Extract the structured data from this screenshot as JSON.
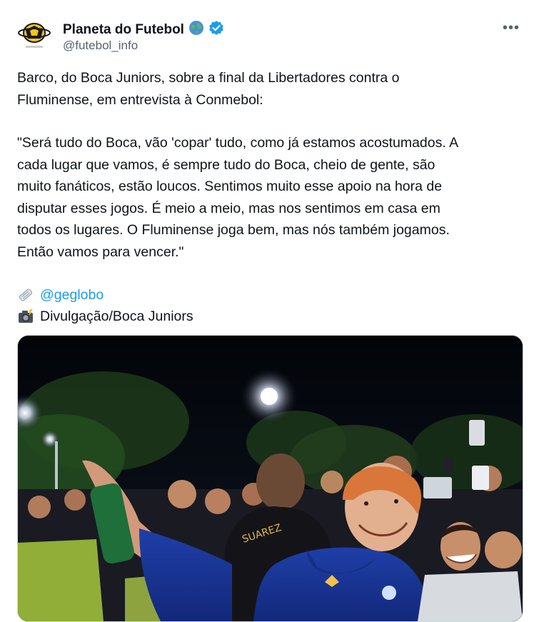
{
  "account": {
    "name": "Planeta do Futebol",
    "handle": "@futebol_info",
    "verified": true,
    "name_emoji": "globe-icon",
    "avatar": "planeta-futebol-logo"
  },
  "more_label": "•••",
  "post": {
    "intro": "Barco, do Boca Juniors, sobre a final da Libertadores contra o\nFluminense, em entrevista à Conmebol:",
    "quote": "\"Será tudo do Boca, vão 'copar' tudo, como já estamos acostumados. A\ncada lugar que vamos, é sempre tudo do Boca, cheio de gente, são\nmuito fanáticos, estão loucos. Sentimos muito esse apoio na hora de\ndisputar esses jogos. É meio a meio, mas nos sentimos em casa em\ntodos os lugares. O Fluminense joga bem, mas nós também jogamos.\nEntão vamos para vencer.\"",
    "source_mention": "@geglobo",
    "photo_credit": "Divulgação/Boca Juniors"
  },
  "media": {
    "description_icon": "photo",
    "shirt_text": "SUAREZ"
  },
  "colors": {
    "link": "#1d9bf0",
    "verified": "#1d9bf0",
    "text": "#0f1419",
    "secondary": "#536471"
  }
}
